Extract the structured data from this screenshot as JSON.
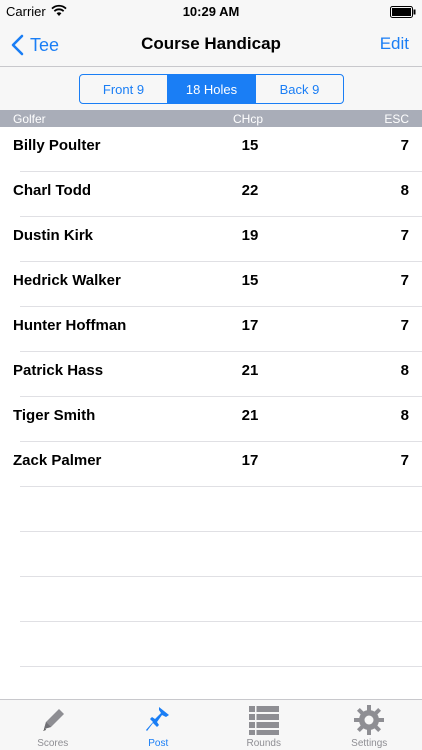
{
  "status_bar": {
    "carrier": "Carrier",
    "time": "10:29 AM"
  },
  "nav": {
    "back_label": "Tee",
    "title": "Course Handicap",
    "edit_label": "Edit"
  },
  "segments": {
    "items": [
      "Front 9",
      "18 Holes",
      "Back 9"
    ],
    "selected": "18 Holes"
  },
  "table": {
    "headers": {
      "golfer": "Golfer",
      "chcp": "CHcp",
      "esc": "ESC"
    },
    "rows": [
      {
        "name": "Billy Poulter",
        "chcp": "15",
        "esc": "7"
      },
      {
        "name": "Charl Todd",
        "chcp": "22",
        "esc": "8"
      },
      {
        "name": "Dustin Kirk",
        "chcp": "19",
        "esc": "7"
      },
      {
        "name": "Hedrick Walker",
        "chcp": "15",
        "esc": "7"
      },
      {
        "name": "Hunter Hoffman",
        "chcp": "17",
        "esc": "7"
      },
      {
        "name": "Patrick Hass",
        "chcp": "21",
        "esc": "8"
      },
      {
        "name": "Tiger Smith",
        "chcp": "21",
        "esc": "8"
      },
      {
        "name": "Zack Palmer",
        "chcp": "17",
        "esc": "7"
      }
    ]
  },
  "tabs": {
    "items": [
      {
        "label": "Scores",
        "icon": "pencil-icon"
      },
      {
        "label": "Post",
        "icon": "pushpin-icon"
      },
      {
        "label": "Rounds",
        "icon": "list-icon"
      },
      {
        "label": "Settings",
        "icon": "gear-icon"
      }
    ],
    "active": "Post"
  },
  "colors": {
    "accent": "#1a7ef5",
    "header_bg": "#a9adb8",
    "bar_bg": "#f7f7f7",
    "inactive_tab": "#8e8e93"
  }
}
